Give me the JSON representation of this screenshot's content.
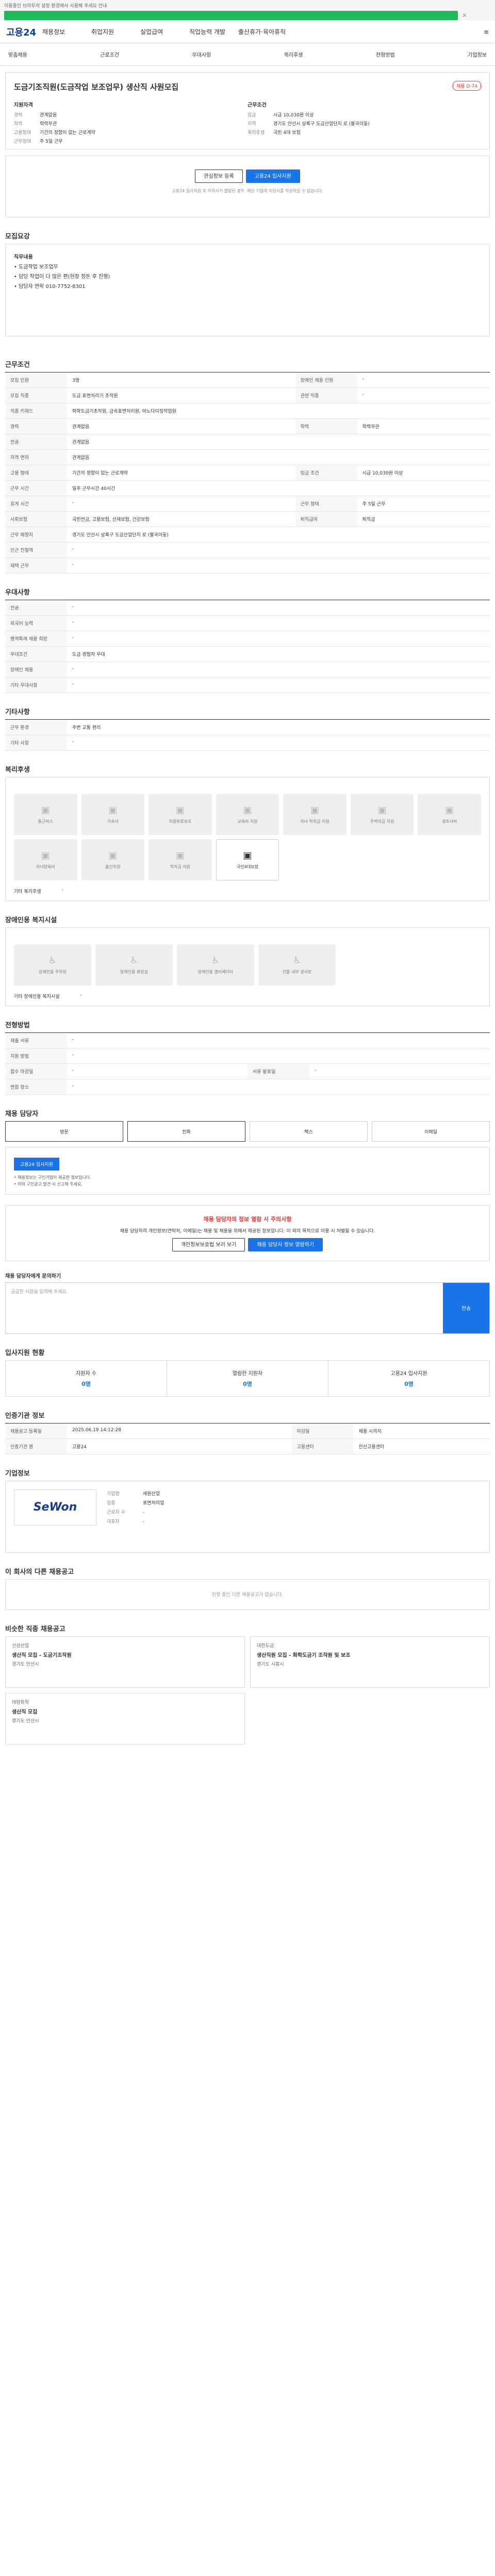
{
  "notice": {
    "text": "이용중인 브라우저 설정 환경에서 사용해 주세요 안내"
  },
  "header": {
    "logo": "고용24",
    "menus": [
      "채용정보",
      "취업지원",
      "실업급여",
      "직업능력 개발",
      "출산휴가·육아휴직"
    ],
    "right": "≡"
  },
  "subnav": [
    "맞춤채용",
    "근로조건",
    "우대사항",
    "복리후생",
    "전형방법",
    "기업정보"
  ],
  "job": {
    "company": "도금기조직원(도금작업 보조업무) 생산직 사원모집",
    "title": "도금기조직원(도금작업 보조업무) 생산직 사원모집",
    "badge": "채용 D-74",
    "left_head": "지원자격",
    "left": [
      {
        "k": "경력",
        "v": "관계없음"
      },
      {
        "k": "학력",
        "v": "학력무관"
      },
      {
        "k": "",
        "v": ""
      },
      {
        "k": "고용형태",
        "v": ""
      },
      {
        "k": "고용형태",
        "v": "기간의 정함이 없는 근로계약"
      },
      {
        "k": "근무형태",
        "v": "주 5일 근무"
      }
    ],
    "right_head": "근무조건",
    "right": [
      {
        "k": "임금",
        "v": "시급 10,030원 이상"
      },
      {
        "k": "지역",
        "v": "경기도 안산시 상록구 도금산업단지 로 (팔곡이동)"
      },
      {
        "k": "",
        "v": ""
      },
      {
        "k": "복리후생",
        "v": ""
      },
      {
        "k": "",
        "v": "국민 4대 보험"
      }
    ]
  },
  "actions": {
    "scrap": "관심정보 등록",
    "apply": "고용24 입사지원",
    "note": "고용24 입사지원 후 이력서가 열람된 경우, 해당 기업에 지원서를 작성하실 수 없습니다."
  },
  "sections": {
    "desc": "모집요강",
    "cond": "근무조건",
    "pref": "우대사항",
    "etc": "기타사항",
    "welfare": "복리후생",
    "disab": "장애인용 복지시설",
    "method": "전형방법",
    "proc": "채용 담당자",
    "stats": "입사지원 현황",
    "recruiter": "인증기관 정보",
    "company": "기업정보",
    "others": "이 회사의 다른 채용공고",
    "recommend": "비슷한 직종 채용공고"
  },
  "desc": {
    "head": "직무내용",
    "lines": [
      "• 도금작업 보조업무",
      "• 담당 작업이 다 많은 편(현장 정돈 후 진행)",
      "• 담당자 연락 010-7752-8301"
    ]
  },
  "cond_rows": [
    [
      "모집 인원",
      "3명",
      "장애인 채용 인원",
      "-"
    ],
    [
      "모집 직종",
      "도금 표면처리기 조작원",
      "관련 직종",
      "-"
    ],
    [
      "직종 키워드",
      "화학도금기조작원, 금속표면처리원, 아노다이징작업원",
      "",
      ""
    ],
    [
      "경력",
      "관계없음",
      "학력",
      "학력무관"
    ],
    [
      "전공",
      "관계없음",
      "",
      ""
    ],
    [
      "자격 면허",
      "관계없음",
      "",
      ""
    ],
    [
      "고용 형태",
      "기간의 정함이 없는 근로계약",
      "임금 조건",
      "시급 10,030원 이상"
    ],
    [
      "근무 시간",
      "일주 근무시간 40시간",
      "",
      ""
    ],
    [
      "휴게 시간",
      "-",
      "근무 형태",
      "주 5일 근무"
    ],
    [
      "사회보험",
      "국민연금, 고용보험, 산재보험, 건강보험",
      "퇴직급여",
      "퇴직금"
    ],
    [
      "근무 예정지",
      "경기도 안산시 상록구 도금산업단지 로 (팔곡이동)",
      "",
      ""
    ],
    [
      "인근 전철역",
      "-",
      "",
      ""
    ],
    [
      "재택 근무",
      "-",
      "",
      ""
    ]
  ],
  "pref_rows": [
    [
      "전공",
      "-"
    ],
    [
      "외국어 능력",
      "-"
    ],
    [
      "병역특례 채용 희망",
      "-"
    ],
    [
      "우대조건",
      "도금 경험자 우대"
    ],
    [
      "장애인 채용",
      "-"
    ],
    [
      "기타 우대사항",
      "-"
    ]
  ],
  "etc_rows": [
    [
      "근무 환경",
      "주변 교통 편리"
    ],
    [
      "기타 사항",
      "-"
    ]
  ],
  "welfare": {
    "tiles": [
      "통근버스",
      "기숙사",
      "차량유류보조",
      "교육비 지원",
      "자녀 학자금 지원",
      "주택자금 지원",
      "경조사비",
      "자녀양육비",
      "출산지원",
      "학자금 지원",
      "국민4대보험"
    ],
    "on_index": 10,
    "extra_label": "기타 복리후생",
    "extra": "-"
  },
  "disab": {
    "tiles": [
      "장애인용 주차장",
      "장애인용 화장실",
      "장애인용 엘리베이터",
      "건물 내부 경사로"
    ],
    "extra_label": "기타 장애인용 복지시설",
    "extra": "-"
  },
  "method_rows": [
    [
      "제출 서류",
      "-",
      "",
      ""
    ],
    [
      "지원 방법",
      "-",
      "",
      ""
    ],
    [
      "접수 마감일",
      "-",
      "서류 발표일",
      "-"
    ],
    [
      "면접 장소",
      "-",
      "",
      ""
    ]
  ],
  "contact": {
    "heads": [
      "방문",
      "전화",
      "팩스",
      "이메일"
    ],
    "btn": "고용24 입사지원",
    "notes": [
      "• 채용정보는 구인기업이 제공한 정보입니다.",
      "• 허위 구인광고 발견 시 신고해 주세요."
    ]
  },
  "warn": {
    "title": "채용 담당자의 정보 열람 시 주의사항",
    "text": "채용 담당자의 개인정보(연락처, 이메일)는 채용 및 채용을 위해서 제공된 정보입니다. 이 외의 목적으로 이용 시 처벌될 수 있습니다.",
    "btn1": "개인정보보호법 보러 보기",
    "btn2": "채용 담당자 정보 열람하기"
  },
  "inquiry": {
    "head": "채용 담당자에게 문의하기",
    "placeholder": "궁금한 사항을 입력해 주세요.",
    "btn": "전송"
  },
  "stats": [
    {
      "k": "지원자 수",
      "v": "0명"
    },
    {
      "k": "열람한 지원자",
      "v": "0명"
    },
    {
      "k": "고용24 입사지원",
      "v": "0명"
    }
  ],
  "recruiter_rows": [
    [
      "채용공고 등록일",
      "2025.06.19 14:12:28",
      "마감일",
      "채용 시까지"
    ],
    [
      "인증기관 명",
      "고용24",
      "고용센터",
      "안산고용센터"
    ]
  ],
  "company": {
    "logo": "SeWon",
    "rows": [
      [
        "기업명",
        "세원산업"
      ],
      [
        "업종",
        "표면처리업"
      ],
      [
        "근로자 수",
        "-"
      ],
      [
        "대표자",
        "-"
      ]
    ]
  },
  "others_empty": "진행 중인 다른 채용공고가 없습니다.",
  "recommend": [
    {
      "company": "신성산업",
      "title": "생산직 모집 - 도금기조작원",
      "loc": "경기도 안산시"
    },
    {
      "company": "대한도금",
      "title": "생산직원 모집 - 화학도금기 조작원 및 보조",
      "loc": "경기도 시흥시"
    },
    {
      "company": "태양화학",
      "title": "생산직 모집",
      "loc": "경기도 안산시"
    }
  ]
}
